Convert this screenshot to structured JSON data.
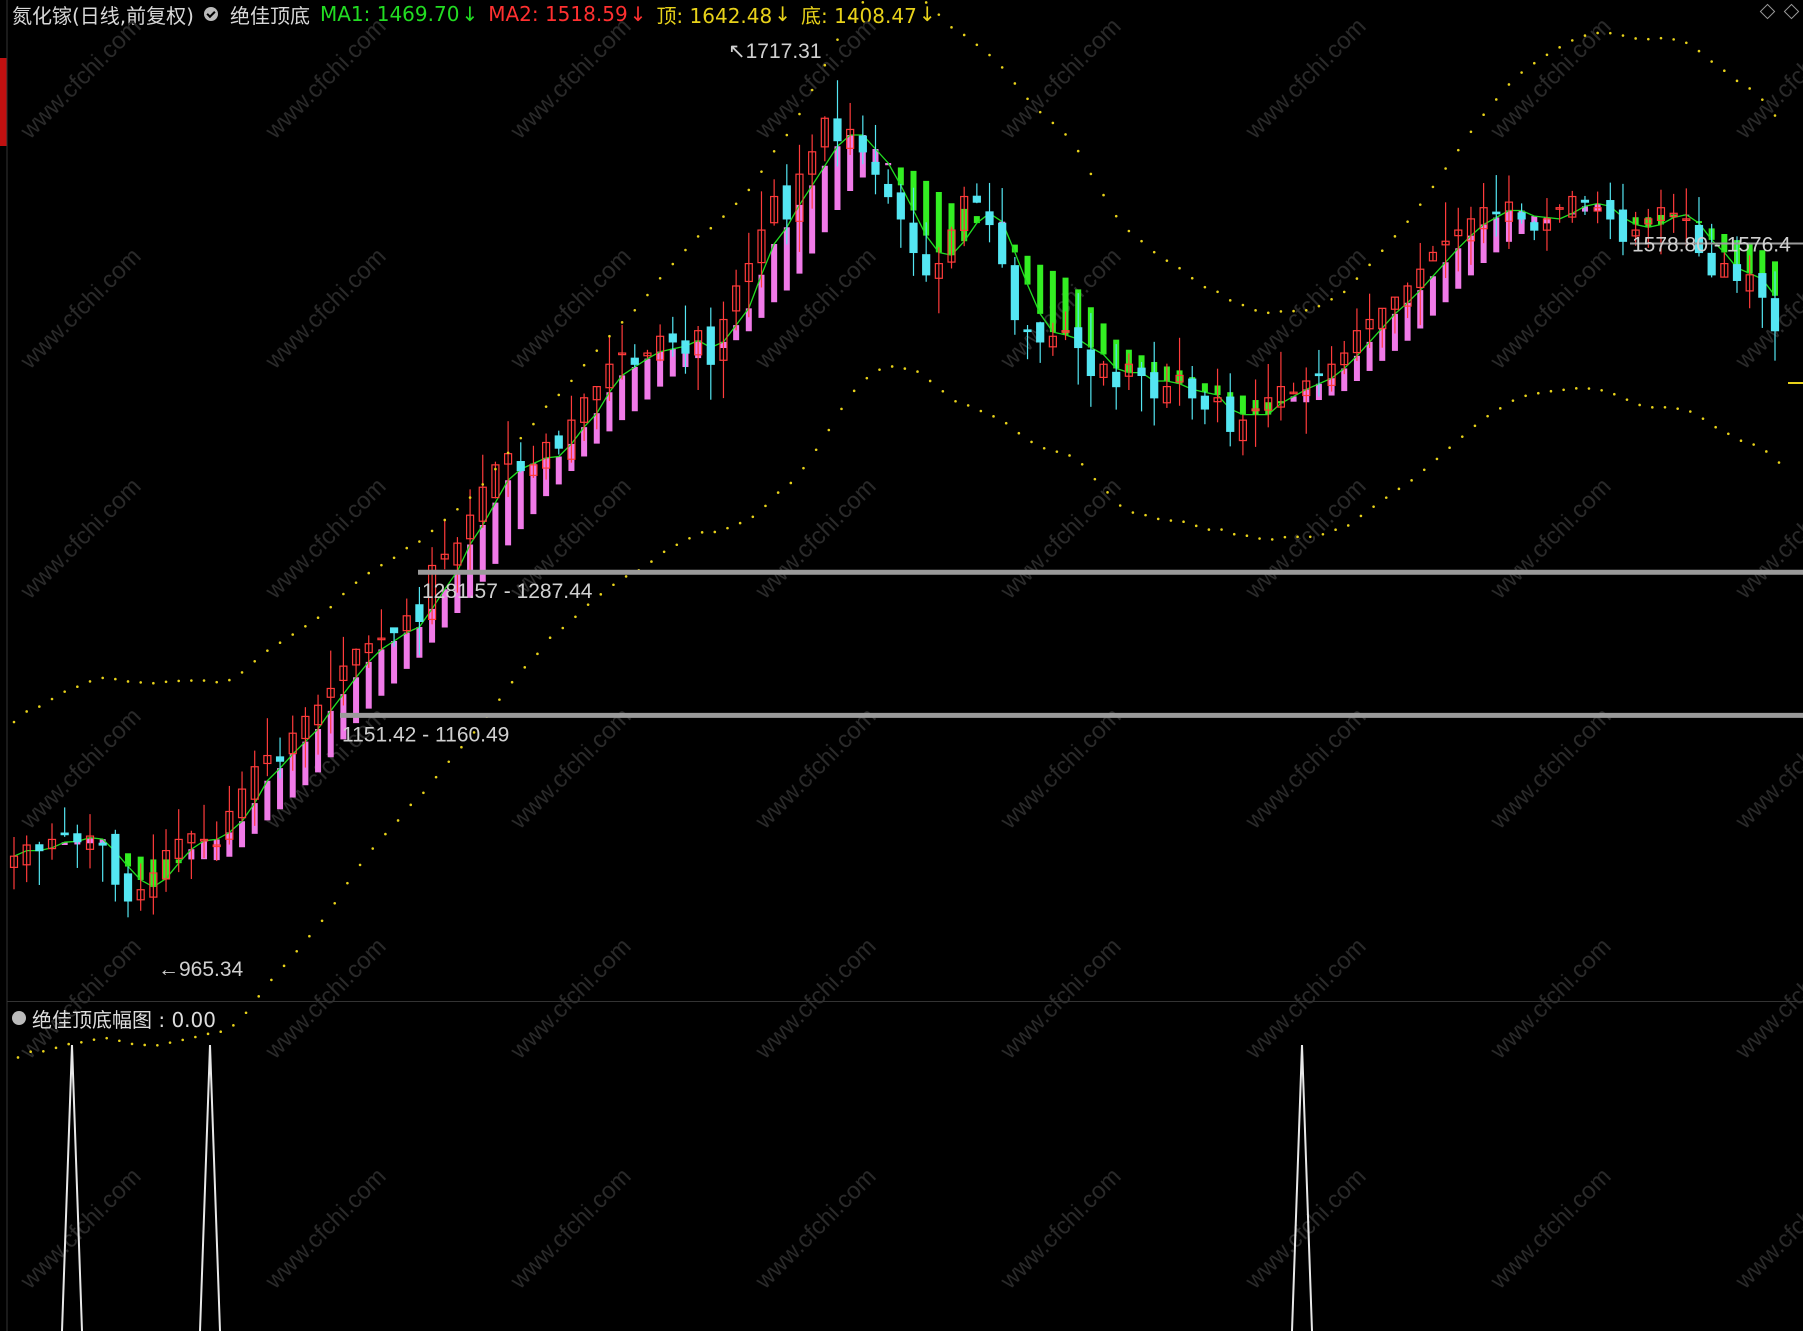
{
  "header": {
    "stock": "氮化镓(日线,前复权)",
    "indicator": "绝佳顶底",
    "ma1": "MA1: 1469.70",
    "ma2": "MA2: 1518.59",
    "top": "顶: 1642.48",
    "bottom": "底: 1408.47"
  },
  "subpanel": {
    "title": "绝佳顶底幅图 : 0.00"
  },
  "labels": {
    "high": "1717.31",
    "low": "965.34",
    "zone1": "1281.57 - 1287.44",
    "zone2": "1151.42 - 1160.49",
    "zone3": "1578.80 - 1576.4"
  },
  "watermark": "www.cfchi.com",
  "colors": {
    "up": "#ff3b3b",
    "down": "#54e6f2",
    "bull_band": "#f07ae8",
    "bear_band": "#33ee22",
    "ma1": "#22dd22",
    "ma2": "#ff3030",
    "yellow": "#e8d21a",
    "line_gray": "#9a9a9a"
  },
  "chart_data": {
    "type": "candlestick",
    "x_count": 140,
    "y_range": [
      930,
      1760
    ],
    "close": [
      1030,
      1040,
      1035,
      1045,
      1050,
      1043,
      1048,
      1040,
      1005,
      990,
      1000,
      1015,
      1035,
      1045,
      1050,
      1045,
      1040,
      1070,
      1090,
      1110,
      1120,
      1115,
      1140,
      1155,
      1165,
      1180,
      1200,
      1215,
      1220,
      1225,
      1230,
      1245,
      1240,
      1290,
      1300,
      1310,
      1335,
      1360,
      1380,
      1390,
      1375,
      1380,
      1400,
      1395,
      1420,
      1440,
      1450,
      1470,
      1480,
      1470,
      1480,
      1495,
      1490,
      1480,
      1500,
      1470,
      1510,
      1540,
      1560,
      1590,
      1620,
      1600,
      1640,
      1660,
      1690,
      1670,
      1680,
      1660,
      1640,
      1620,
      1600,
      1570,
      1550,
      1560,
      1590,
      1620,
      1615,
      1595,
      1560,
      1510,
      1500,
      1490,
      1495,
      1500,
      1485,
      1460,
      1470,
      1450,
      1470,
      1460,
      1440,
      1450,
      1460,
      1440,
      1430,
      1440,
      1410,
      1420,
      1430,
      1440,
      1450,
      1445,
      1455,
      1460,
      1470,
      1480,
      1500,
      1510,
      1520,
      1530,
      1540,
      1555,
      1570,
      1580,
      1590,
      1600,
      1610,
      1605,
      1615,
      1600,
      1590,
      1600,
      1610,
      1620,
      1615,
      1610,
      1600,
      1580,
      1590,
      1600,
      1610,
      1605,
      1600,
      1570,
      1550,
      1560,
      1545,
      1550,
      1530,
      1500
    ],
    "low_value": 965.34,
    "high_value": 1717.31
  }
}
